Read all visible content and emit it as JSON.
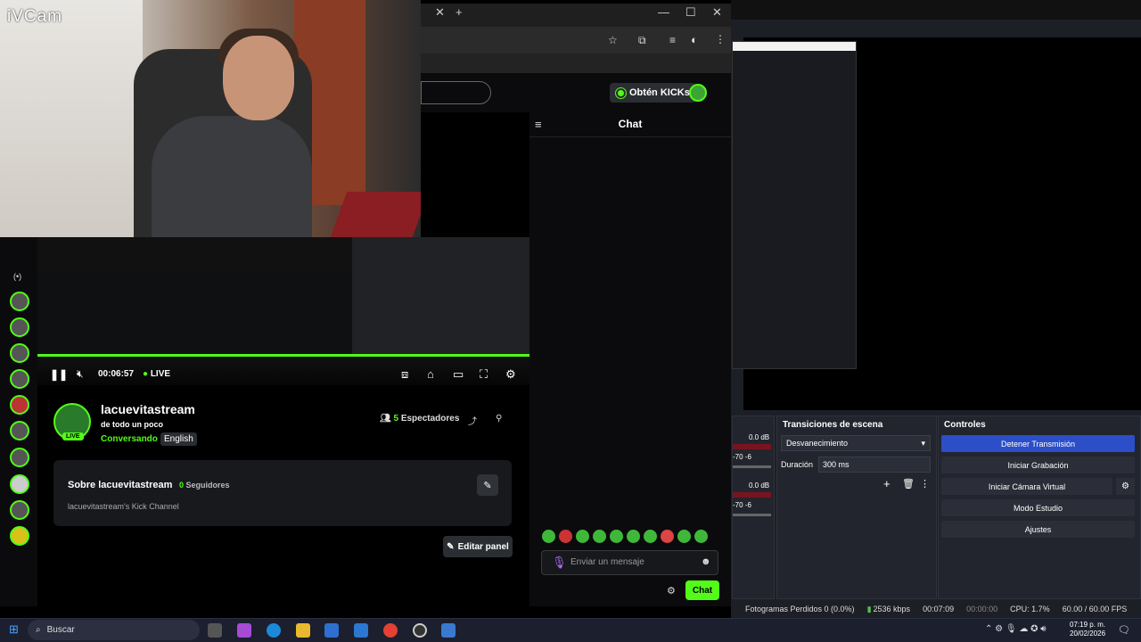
{
  "webcam": {
    "label": "iVCam"
  },
  "browser": {
    "window_controls": {
      "minimize": "—",
      "maximize": "☐",
      "close": "✕"
    },
    "new_tab": "+",
    "tab_close": "✕"
  },
  "kick": {
    "kicks_button": "Obtén KICKs",
    "chat_title": "Chat",
    "message_placeholder": "Enviar un mensaje",
    "chat_button": "Chat",
    "player": {
      "time": "00:06:57",
      "live": "LIVE"
    },
    "channel": {
      "name": "lacuevitastream",
      "subtitle": "de todo un poco",
      "category": "Conversando",
      "language": "English",
      "viewers_count": "5",
      "viewers_label": "Espectadores",
      "live_badge": "LIVE"
    },
    "about": {
      "title": "Sobre lacuevitastream",
      "followers_count": "0",
      "followers_label": "Seguidores",
      "description": "lacuevitastream's Kick Channel"
    },
    "edit_panel": "Editar panel"
  },
  "obs": {
    "audio": [
      {
        "db": "0.0 dB",
        "scale": "-70 -6"
      },
      {
        "db": "0.0 dB",
        "scale": "-70 -6"
      }
    ],
    "transitions": {
      "title": "Transiciones de escena",
      "selected": "Desvanecimiento",
      "duration_label": "Duración",
      "duration_value": "300 ms"
    },
    "controls": {
      "title": "Controles",
      "buttons": [
        "Detener Transmisión",
        "Iniciar Grabación",
        "Iniciar Cámara Virtual",
        "Modo Estudio",
        "Ajustes"
      ]
    },
    "status": {
      "dropped": "Fotogramas Perdidos 0 (0.0%)",
      "bitrate": "2536 kbps",
      "stream_time": "00:07:09",
      "rec_time": "00:00:00",
      "cpu": "CPU: 1.7%",
      "fps": "60.00 / 60.00 FPS"
    }
  },
  "taskbar": {
    "search_placeholder": "Buscar",
    "time": "07:19 p. m.",
    "date": "20/02/2026"
  },
  "colors": {
    "kick_green": "#53fc18",
    "obs_accent": "#2c4ec8"
  }
}
